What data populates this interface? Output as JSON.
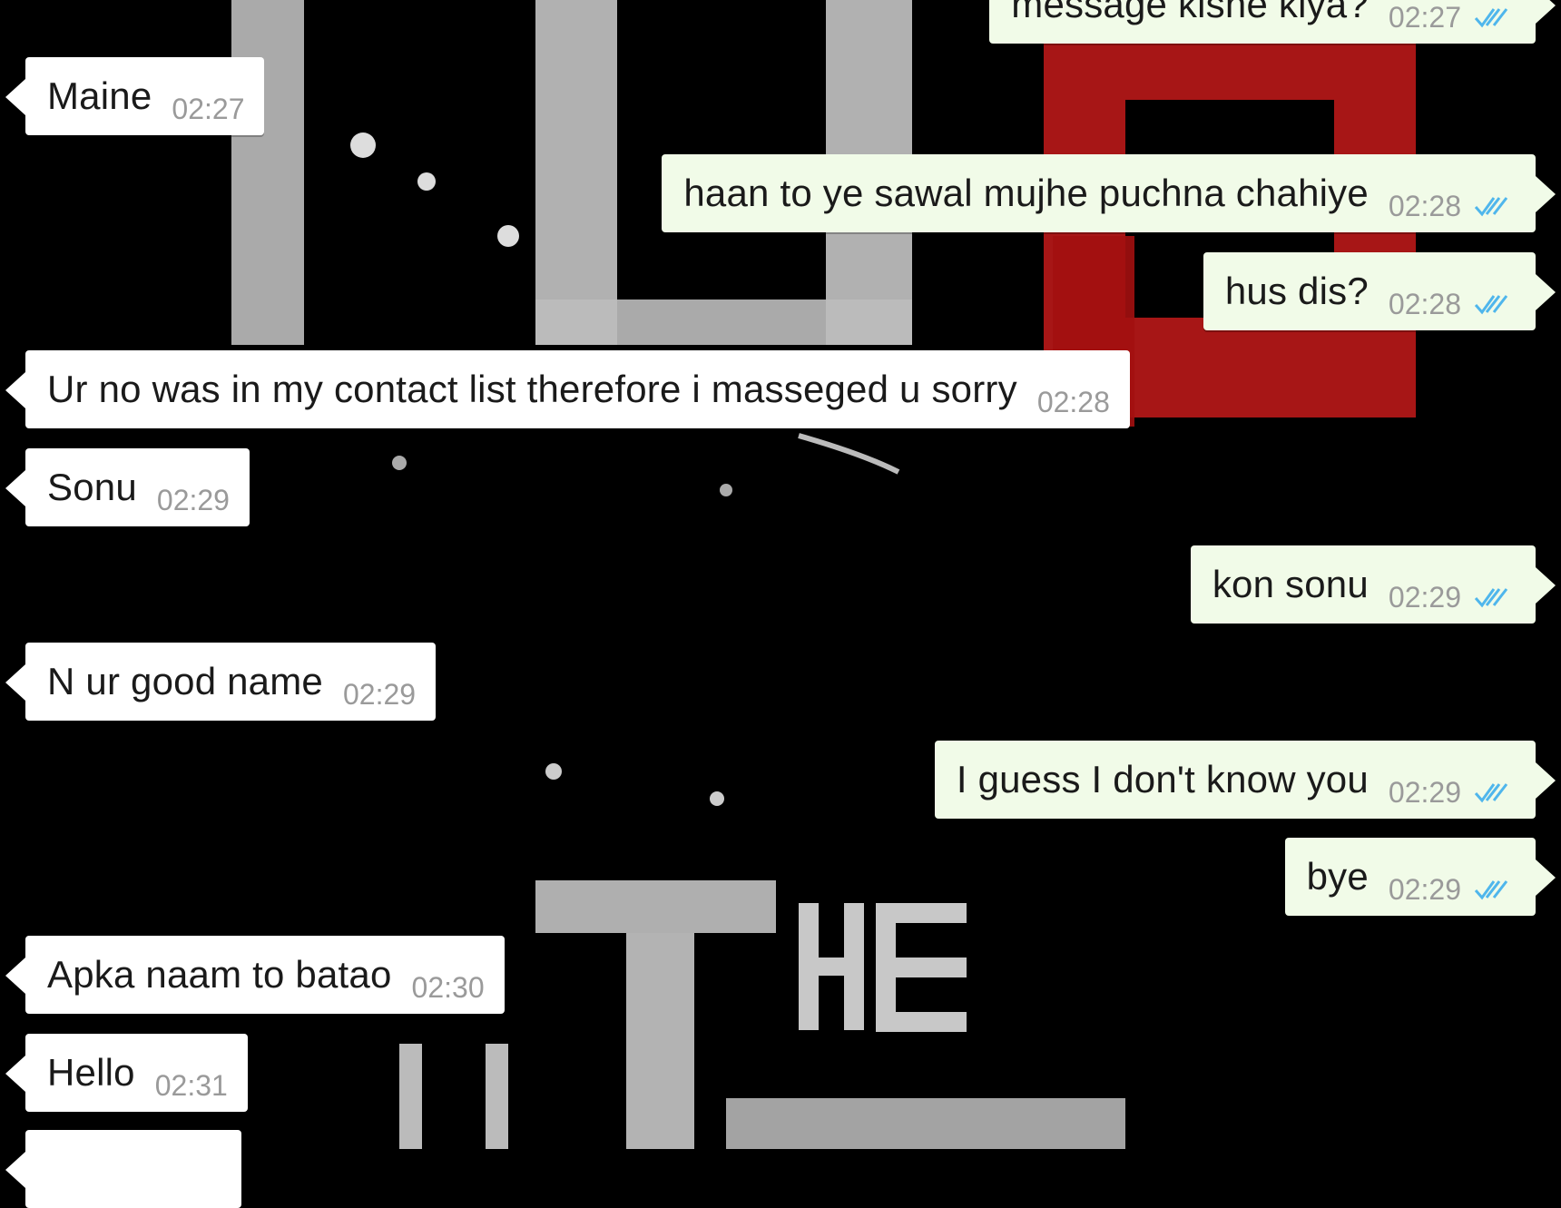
{
  "colors": {
    "incoming_bubble": "#ffffff",
    "outgoing_bubble": "#f1fbe8",
    "timestamp": "#9a9a9a",
    "read_ticks": "#4fb6ec",
    "wallpaper_red": "#c41a1a"
  },
  "messages": [
    {
      "direction": "out",
      "text": "message kisne kiya?",
      "time": "02:27",
      "status_icon": "double-tick-icon"
    },
    {
      "direction": "in",
      "text": "Maine",
      "time": "02:27"
    },
    {
      "direction": "out",
      "text": "haan to ye sawal mujhe puchna chahiye",
      "time": "02:28",
      "status_icon": "double-tick-icon"
    },
    {
      "direction": "out",
      "text": "hus dis?",
      "time": "02:28",
      "status_icon": "double-tick-icon"
    },
    {
      "direction": "in",
      "text": "Ur no was in my contact list therefore i masseged u sorry",
      "time": "02:28"
    },
    {
      "direction": "in",
      "text": "Sonu",
      "time": "02:29"
    },
    {
      "direction": "out",
      "text": "kon sonu",
      "time": "02:29",
      "status_icon": "double-tick-icon"
    },
    {
      "direction": "in",
      "text": "N ur good name",
      "time": "02:29"
    },
    {
      "direction": "out",
      "text": "I guess I don't know you",
      "time": "02:29",
      "status_icon": "double-tick-icon"
    },
    {
      "direction": "out",
      "text": "bye",
      "time": "02:29",
      "status_icon": "double-tick-icon"
    },
    {
      "direction": "in",
      "text": "Apka naam to batao",
      "time": "02:30"
    },
    {
      "direction": "in",
      "text": "Hello",
      "time": "02:31"
    }
  ]
}
